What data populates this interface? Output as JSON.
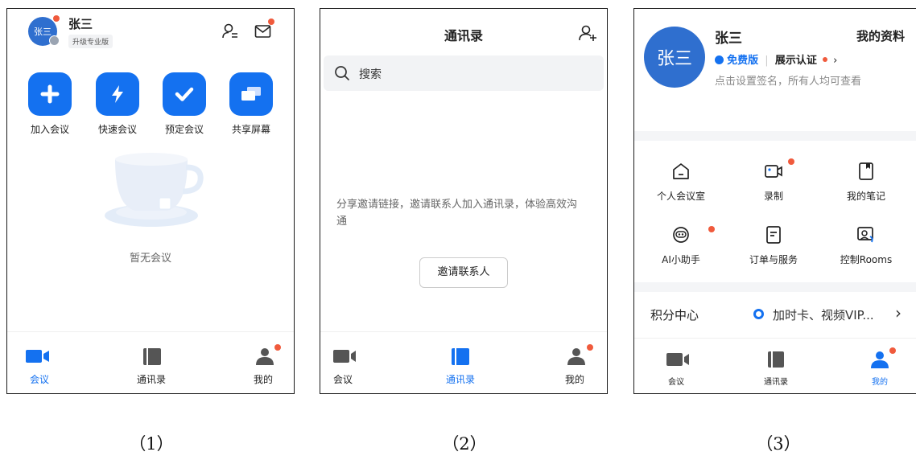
{
  "screen1": {
    "user_name": "张三",
    "avatar_text": "张三",
    "upgrade_badge": "升级专业版",
    "actions": [
      {
        "label": "加入会议",
        "icon": "plus-icon"
      },
      {
        "label": "快速会议",
        "icon": "lightning-icon"
      },
      {
        "label": "预定会议",
        "icon": "check-icon"
      },
      {
        "label": "共享屏幕",
        "icon": "share-screen-icon"
      }
    ],
    "empty_text": "暂无会议",
    "tabs": [
      "会议",
      "通讯录",
      "我的"
    ]
  },
  "screen2": {
    "title": "通讯录",
    "search_placeholder": "搜索",
    "share_text": "分享邀请链接，邀请联系人加入通讯录，体验高效沟通",
    "invite_button": "邀请联系人",
    "tabs": [
      "会议",
      "通讯录",
      "我的"
    ]
  },
  "screen3": {
    "avatar_text": "张三",
    "user_name": "张三",
    "my_profile": "我的资料",
    "plan": "免费版",
    "certify": "展示认证",
    "signature_hint": "点击设置签名，所有人均可查看",
    "grid": [
      {
        "label": "个人会议室",
        "icon": "home-icon"
      },
      {
        "label": "录制",
        "icon": "video-record-icon"
      },
      {
        "label": "我的笔记",
        "icon": "note-icon"
      },
      {
        "label": "AI小助手",
        "icon": "robot-icon"
      },
      {
        "label": "订单与服务",
        "icon": "order-icon"
      },
      {
        "label": "控制Rooms",
        "icon": "rooms-control-icon"
      }
    ],
    "points_title": "积分中心",
    "points_desc": "加时卡、视频VIP...",
    "tabs": [
      "会议",
      "通讯录",
      "我的"
    ]
  },
  "captions": [
    "（1）",
    "（2）",
    "（3）"
  ],
  "colors": {
    "brand": "#1471f0",
    "badge": "#f05a3c",
    "avatar": "#2f6fcf"
  }
}
